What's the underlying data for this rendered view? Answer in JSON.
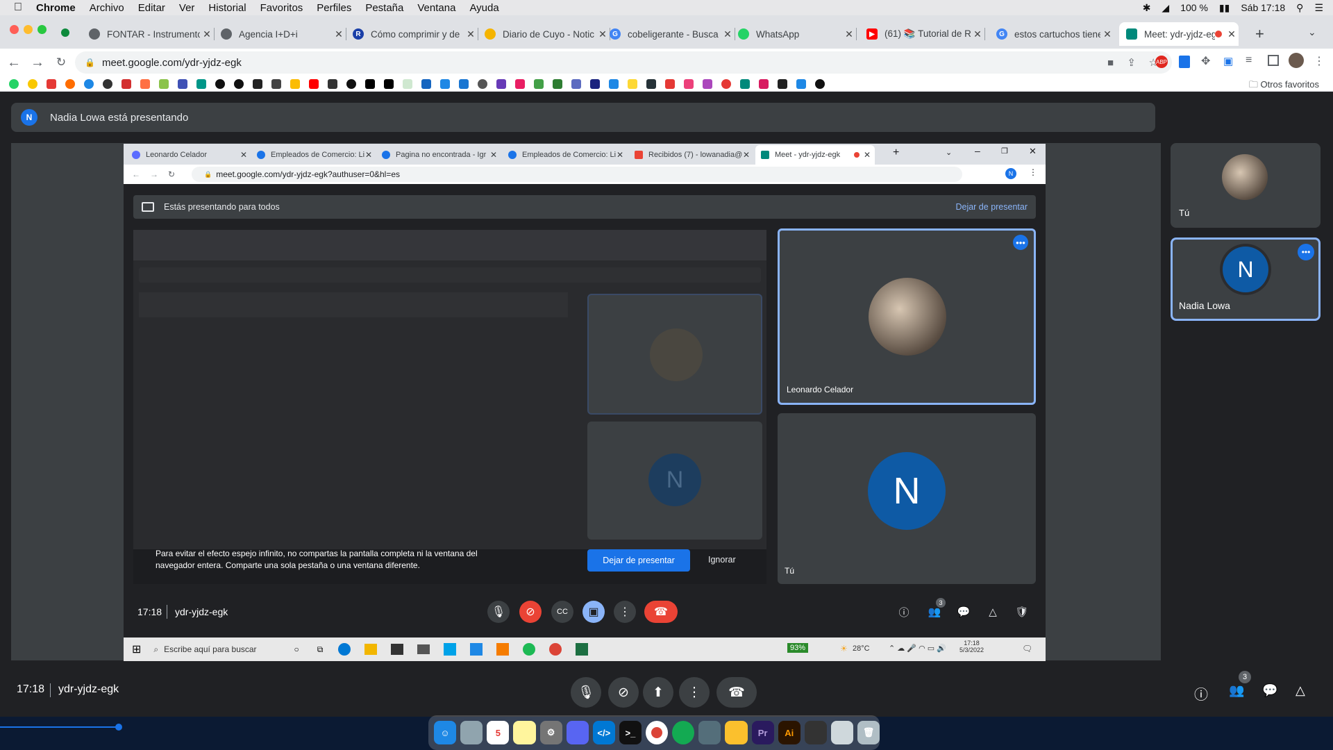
{
  "mac_menu": {
    "app": "Chrome",
    "items": [
      "Archivo",
      "Editar",
      "Ver",
      "Historial",
      "Favoritos",
      "Perfiles",
      "Pestaña",
      "Ventana",
      "Ayuda"
    ],
    "battery": "100 %",
    "clock": "Sáb 17:18"
  },
  "browser_tabs": [
    {
      "title": "FONTAR - Instrumento",
      "color": "#5f6368"
    },
    {
      "title": "Agencia I+D+i",
      "color": "#5f6368"
    },
    {
      "title": "Cómo comprimir y de",
      "color": "#1a3fa8"
    },
    {
      "title": "Diario de Cuyo - Notic",
      "color": "#f5b400"
    },
    {
      "title": "cobeligerante - Busca",
      "color": "#4285f4"
    },
    {
      "title": "WhatsApp",
      "color": "#25d366"
    },
    {
      "title": "(61) 📚 Tutorial de Re",
      "color": "#ff0000"
    },
    {
      "title": "estos cartuchos tiene",
      "color": "#4285f4"
    },
    {
      "title": "Meet: ydr-yjdz-eg",
      "color": "#00897b"
    }
  ],
  "address": {
    "url": "meet.google.com/ydr-yjdz-egk"
  },
  "bookmarks": {
    "other": "Otros favoritos"
  },
  "presenting_banner": {
    "initial": "N",
    "text": "Nadia Lowa está presentando"
  },
  "inner": {
    "tabs": [
      {
        "title": "Leonardo Celador",
        "color": "#5b6cff"
      },
      {
        "title": "Empleados de Comercio: Li",
        "color": "#1a73e8"
      },
      {
        "title": "Pagina no encontrada - Igr",
        "color": "#1a73e8"
      },
      {
        "title": "Empleados de Comercio: Li",
        "color": "#1a73e8"
      },
      {
        "title": "Recibidos (7) - lowanadia@",
        "color": "#ea4335"
      },
      {
        "title": "Meet - ydr-yjdz-egk",
        "color": "#00897b"
      }
    ],
    "url": "meet.google.com/ydr-yjdz-egk?authuser=0&hl=es",
    "presenting_for_all": "Estás presentando para todos",
    "stop_presenting": "Dejar de presentar",
    "warning": "Para evitar el efecto espejo infinito, no compartas la pantalla completa ni la ventana del navegador entera. Comparte una sola pestaña o una ventana diferente.",
    "stop_btn": "Dejar de presentar",
    "ignore": "Ignorar",
    "tile_leonardo": "Leonardo Celador",
    "tile_you": "Tú",
    "avatar_initial": "N",
    "time": "17:18",
    "meeting_code": "ydr-yjdz-egk",
    "people_count": "3",
    "taskbar_search": "Escribe aquí para buscar",
    "battery_pct": "93%",
    "temp": "28°C",
    "tb_time": "17:18",
    "tb_date": "5/3/2022"
  },
  "side_tiles": {
    "you": "Tú",
    "nadia": "Nadia Lowa",
    "initial": "N"
  },
  "bottom": {
    "time": "17:18",
    "meeting_code": "ydr-yjdz-egk",
    "people_count": "3"
  }
}
